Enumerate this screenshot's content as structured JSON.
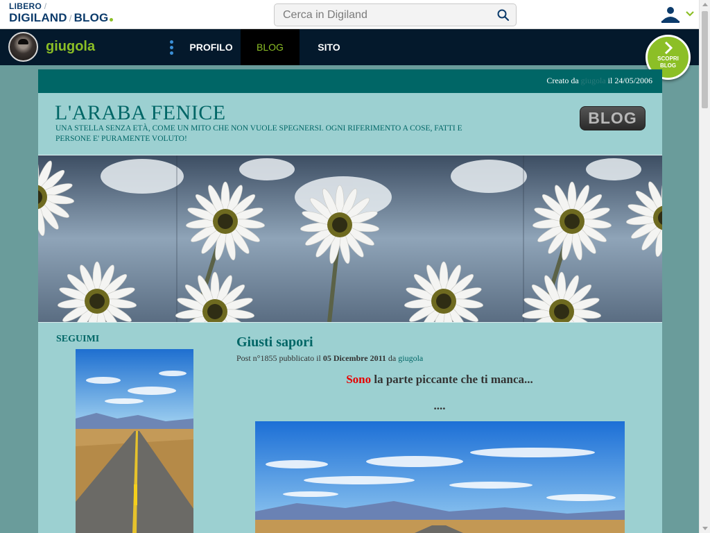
{
  "topbar": {
    "logo_line1": "LIBERO",
    "logo_line1_sep": "/",
    "logo_line2_a": "DIGILAND",
    "logo_line2_sep": "/",
    "logo_line2_b": "BLOG",
    "search_placeholder": "Cerca in Digiland",
    "search_icon": "search-icon",
    "user_icon": "user-icon"
  },
  "nav": {
    "nickname": "giugola",
    "tabs": [
      {
        "label": "PROFILO",
        "active": false
      },
      {
        "label": "BLOG",
        "active": true
      },
      {
        "label": "SITO",
        "active": false
      }
    ],
    "scopri_line1": "SCOPRI",
    "scopri_line2": "BLOG"
  },
  "blog": {
    "created_prefix": "Creato da",
    "created_author": "giugola",
    "created_suffix": "il 24/05/2006",
    "title": "L'ARABA FENICE",
    "subtitle": "UNA STELLA SENZA ETÀ, COME UN MITO CHE NON VUOLE SPEGNERSI. OGNI RIFERIMENTO A COSE, FATTI E PERSONE E' PURAMENTE VOLUTO!",
    "badge": "BLOG"
  },
  "sidebar": {
    "title": "SEGUIMI"
  },
  "post": {
    "title": "Giusti sapori",
    "meta_prefix": "Post n°1855 pubblicato il",
    "meta_date": "05 Dicembre 2011",
    "meta_da": "da",
    "meta_author": "giugola",
    "line_red": "Sono",
    "line_rest": "la parte piccante che ti manca...",
    "dots": "...."
  },
  "colors": {
    "accent_green": "#8cbf26",
    "nav_bg": "#04192c",
    "blog_teal": "#006666",
    "page_bg": "#9cd0d1",
    "outer_bg": "#6a9c9b"
  }
}
